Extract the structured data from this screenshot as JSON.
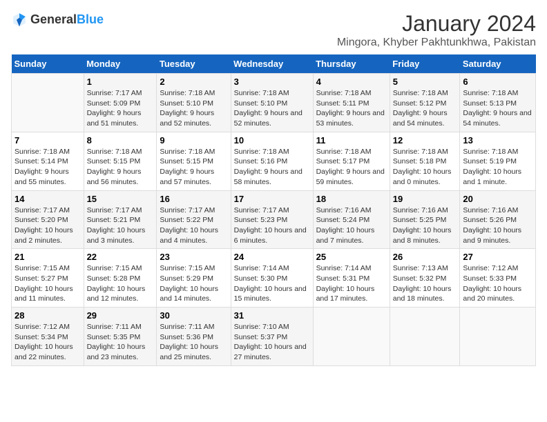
{
  "logo": {
    "general": "General",
    "blue": "Blue"
  },
  "title": "January 2024",
  "subtitle": "Mingora, Khyber Pakhtunkhwa, Pakistan",
  "days_of_week": [
    "Sunday",
    "Monday",
    "Tuesday",
    "Wednesday",
    "Thursday",
    "Friday",
    "Saturday"
  ],
  "weeks": [
    [
      {
        "day": "",
        "sunrise": "",
        "sunset": "",
        "daylight": ""
      },
      {
        "day": "1",
        "sunrise": "Sunrise: 7:17 AM",
        "sunset": "Sunset: 5:09 PM",
        "daylight": "Daylight: 9 hours and 51 minutes."
      },
      {
        "day": "2",
        "sunrise": "Sunrise: 7:18 AM",
        "sunset": "Sunset: 5:10 PM",
        "daylight": "Daylight: 9 hours and 52 minutes."
      },
      {
        "day": "3",
        "sunrise": "Sunrise: 7:18 AM",
        "sunset": "Sunset: 5:10 PM",
        "daylight": "Daylight: 9 hours and 52 minutes."
      },
      {
        "day": "4",
        "sunrise": "Sunrise: 7:18 AM",
        "sunset": "Sunset: 5:11 PM",
        "daylight": "Daylight: 9 hours and 53 minutes."
      },
      {
        "day": "5",
        "sunrise": "Sunrise: 7:18 AM",
        "sunset": "Sunset: 5:12 PM",
        "daylight": "Daylight: 9 hours and 54 minutes."
      },
      {
        "day": "6",
        "sunrise": "Sunrise: 7:18 AM",
        "sunset": "Sunset: 5:13 PM",
        "daylight": "Daylight: 9 hours and 54 minutes."
      }
    ],
    [
      {
        "day": "7",
        "sunrise": "Sunrise: 7:18 AM",
        "sunset": "Sunset: 5:14 PM",
        "daylight": "Daylight: 9 hours and 55 minutes."
      },
      {
        "day": "8",
        "sunrise": "Sunrise: 7:18 AM",
        "sunset": "Sunset: 5:15 PM",
        "daylight": "Daylight: 9 hours and 56 minutes."
      },
      {
        "day": "9",
        "sunrise": "Sunrise: 7:18 AM",
        "sunset": "Sunset: 5:15 PM",
        "daylight": "Daylight: 9 hours and 57 minutes."
      },
      {
        "day": "10",
        "sunrise": "Sunrise: 7:18 AM",
        "sunset": "Sunset: 5:16 PM",
        "daylight": "Daylight: 9 hours and 58 minutes."
      },
      {
        "day": "11",
        "sunrise": "Sunrise: 7:18 AM",
        "sunset": "Sunset: 5:17 PM",
        "daylight": "Daylight: 9 hours and 59 minutes."
      },
      {
        "day": "12",
        "sunrise": "Sunrise: 7:18 AM",
        "sunset": "Sunset: 5:18 PM",
        "daylight": "Daylight: 10 hours and 0 minutes."
      },
      {
        "day": "13",
        "sunrise": "Sunrise: 7:18 AM",
        "sunset": "Sunset: 5:19 PM",
        "daylight": "Daylight: 10 hours and 1 minute."
      }
    ],
    [
      {
        "day": "14",
        "sunrise": "Sunrise: 7:17 AM",
        "sunset": "Sunset: 5:20 PM",
        "daylight": "Daylight: 10 hours and 2 minutes."
      },
      {
        "day": "15",
        "sunrise": "Sunrise: 7:17 AM",
        "sunset": "Sunset: 5:21 PM",
        "daylight": "Daylight: 10 hours and 3 minutes."
      },
      {
        "day": "16",
        "sunrise": "Sunrise: 7:17 AM",
        "sunset": "Sunset: 5:22 PM",
        "daylight": "Daylight: 10 hours and 4 minutes."
      },
      {
        "day": "17",
        "sunrise": "Sunrise: 7:17 AM",
        "sunset": "Sunset: 5:23 PM",
        "daylight": "Daylight: 10 hours and 6 minutes."
      },
      {
        "day": "18",
        "sunrise": "Sunrise: 7:16 AM",
        "sunset": "Sunset: 5:24 PM",
        "daylight": "Daylight: 10 hours and 7 minutes."
      },
      {
        "day": "19",
        "sunrise": "Sunrise: 7:16 AM",
        "sunset": "Sunset: 5:25 PM",
        "daylight": "Daylight: 10 hours and 8 minutes."
      },
      {
        "day": "20",
        "sunrise": "Sunrise: 7:16 AM",
        "sunset": "Sunset: 5:26 PM",
        "daylight": "Daylight: 10 hours and 9 minutes."
      }
    ],
    [
      {
        "day": "21",
        "sunrise": "Sunrise: 7:15 AM",
        "sunset": "Sunset: 5:27 PM",
        "daylight": "Daylight: 10 hours and 11 minutes."
      },
      {
        "day": "22",
        "sunrise": "Sunrise: 7:15 AM",
        "sunset": "Sunset: 5:28 PM",
        "daylight": "Daylight: 10 hours and 12 minutes."
      },
      {
        "day": "23",
        "sunrise": "Sunrise: 7:15 AM",
        "sunset": "Sunset: 5:29 PM",
        "daylight": "Daylight: 10 hours and 14 minutes."
      },
      {
        "day": "24",
        "sunrise": "Sunrise: 7:14 AM",
        "sunset": "Sunset: 5:30 PM",
        "daylight": "Daylight: 10 hours and 15 minutes."
      },
      {
        "day": "25",
        "sunrise": "Sunrise: 7:14 AM",
        "sunset": "Sunset: 5:31 PM",
        "daylight": "Daylight: 10 hours and 17 minutes."
      },
      {
        "day": "26",
        "sunrise": "Sunrise: 7:13 AM",
        "sunset": "Sunset: 5:32 PM",
        "daylight": "Daylight: 10 hours and 18 minutes."
      },
      {
        "day": "27",
        "sunrise": "Sunrise: 7:12 AM",
        "sunset": "Sunset: 5:33 PM",
        "daylight": "Daylight: 10 hours and 20 minutes."
      }
    ],
    [
      {
        "day": "28",
        "sunrise": "Sunrise: 7:12 AM",
        "sunset": "Sunset: 5:34 PM",
        "daylight": "Daylight: 10 hours and 22 minutes."
      },
      {
        "day": "29",
        "sunrise": "Sunrise: 7:11 AM",
        "sunset": "Sunset: 5:35 PM",
        "daylight": "Daylight: 10 hours and 23 minutes."
      },
      {
        "day": "30",
        "sunrise": "Sunrise: 7:11 AM",
        "sunset": "Sunset: 5:36 PM",
        "daylight": "Daylight: 10 hours and 25 minutes."
      },
      {
        "day": "31",
        "sunrise": "Sunrise: 7:10 AM",
        "sunset": "Sunset: 5:37 PM",
        "daylight": "Daylight: 10 hours and 27 minutes."
      },
      {
        "day": "",
        "sunrise": "",
        "sunset": "",
        "daylight": ""
      },
      {
        "day": "",
        "sunrise": "",
        "sunset": "",
        "daylight": ""
      },
      {
        "day": "",
        "sunrise": "",
        "sunset": "",
        "daylight": ""
      }
    ]
  ]
}
